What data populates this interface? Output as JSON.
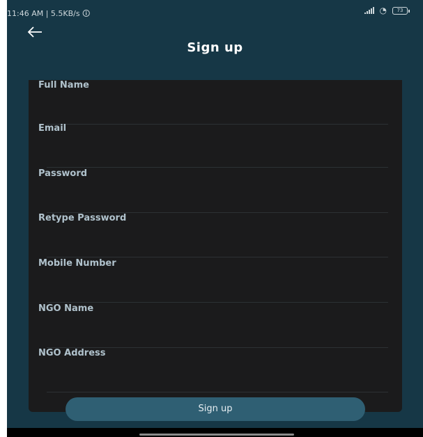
{
  "status_bar": {
    "left_text": "11:46 AM | 5.5KB/s 🛈",
    "battery": "73"
  },
  "header": {
    "title": "Sign up"
  },
  "form": {
    "fields": [
      {
        "label": "Full Name"
      },
      {
        "label": "Email"
      },
      {
        "label": "Password"
      },
      {
        "label": "Retype Password"
      },
      {
        "label": "Mobile Number"
      },
      {
        "label": "NGO Name"
      },
      {
        "label": "NGO Address"
      }
    ]
  },
  "actions": {
    "signup_label": "Sign up"
  },
  "colors": {
    "background": "#163746",
    "card": "#1b1b1c",
    "accent": "#2f5f73",
    "label": "#b0c2cc"
  }
}
